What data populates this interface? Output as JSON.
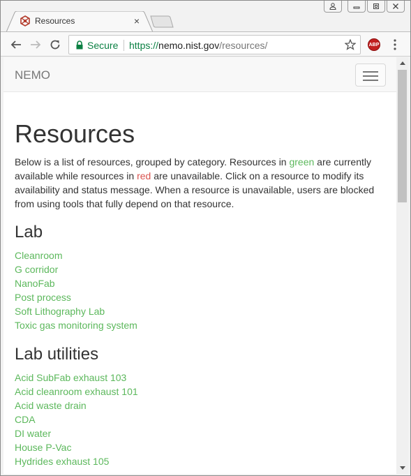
{
  "browser": {
    "tab_title": "Resources",
    "tab_close": "×",
    "secure_label": "Secure",
    "url_scheme": "https://",
    "url_host": "nemo.nist.gov",
    "url_path": "/resources/",
    "adblock_label": "ABP",
    "accent_secure": "#0b8043"
  },
  "navbar": {
    "brand": "NEMO"
  },
  "page": {
    "title": "Resources",
    "intro_part1": "Below is a list of resources, grouped by category. Resources in ",
    "intro_green": "green",
    "intro_part2": " are currently available while resources in ",
    "intro_red": "red",
    "intro_part3": " are unavailable. Click on a resource to modify its availability and status message. When a resource is unavailable, users are blocked from using tools that fully depend on that resource.",
    "available_color": "#5cb85c",
    "unavailable_color": "#d9534f"
  },
  "categories": [
    {
      "name": "Lab",
      "items": [
        "Cleanroom",
        "G corridor",
        "NanoFab",
        "Post process",
        "Soft Lithography Lab",
        "Toxic gas monitoring system"
      ]
    },
    {
      "name": "Lab utilities",
      "items": [
        "Acid SubFab exhaust 103",
        "Acid cleanroom exhaust 101",
        "Acid waste drain",
        "CDA",
        "DI water",
        "House P-Vac",
        "Hydrides exhaust 105"
      ]
    }
  ]
}
